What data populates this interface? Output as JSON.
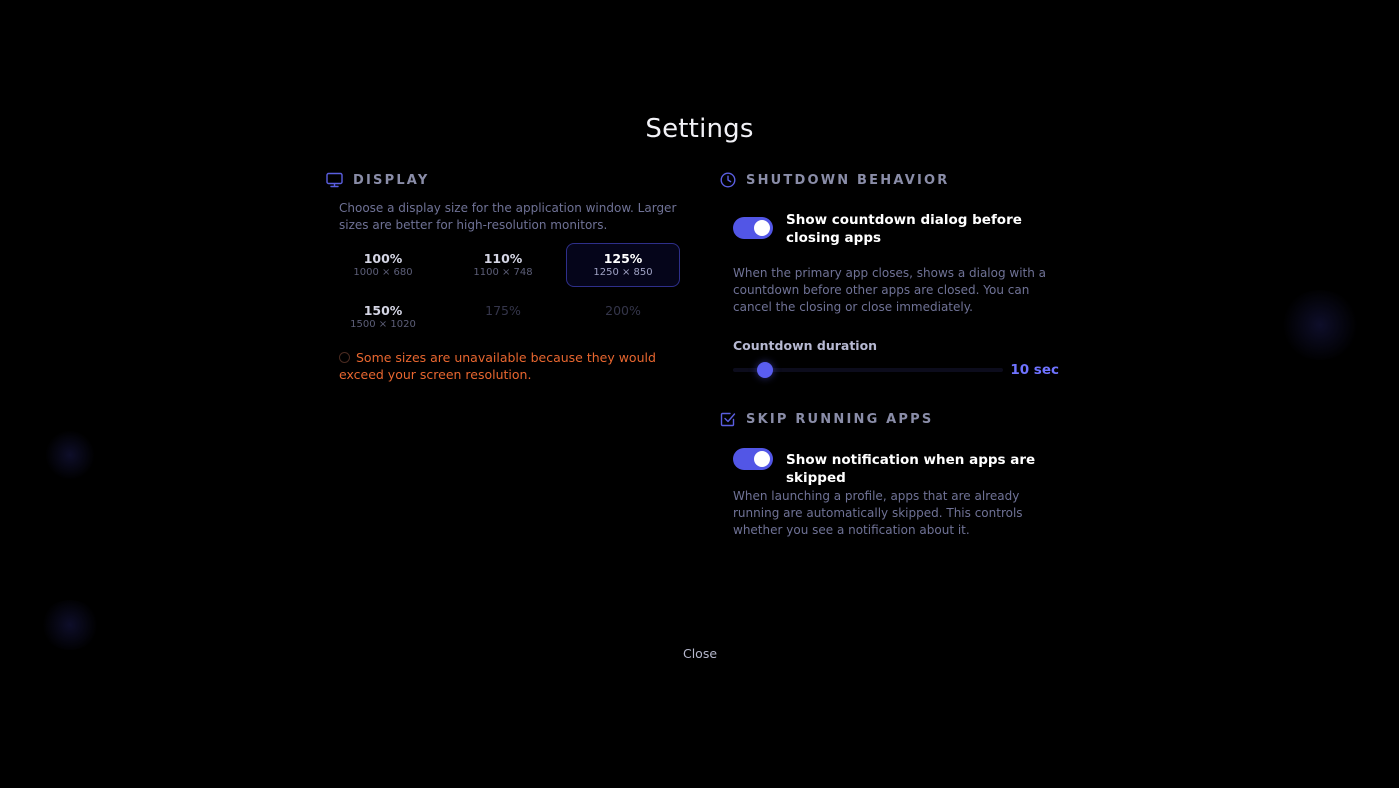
{
  "title": "Settings",
  "colors": {
    "accent": "#5256e6",
    "slider_value": "#6f73ff",
    "warning": "#e8662f",
    "background": "#000000"
  },
  "display": {
    "icon": "monitor-icon",
    "label": "DISPLAY",
    "description": "Choose a display size for the application window. Larger sizes are better for high-resolution monitors.",
    "options": [
      {
        "percent": "100%",
        "dimensions": "1000 × 680",
        "state": "available"
      },
      {
        "percent": "110%",
        "dimensions": "1100 × 748",
        "state": "available"
      },
      {
        "percent": "125%",
        "dimensions": "1250 × 850",
        "state": "selected"
      },
      {
        "percent": "150%",
        "dimensions": "1500 × 1020",
        "state": "available"
      },
      {
        "percent": "175%",
        "dimensions": "",
        "state": "disabled"
      },
      {
        "percent": "200%",
        "dimensions": "",
        "state": "disabled"
      }
    ],
    "warning": "Some sizes are unavailable because they would exceed your screen resolution."
  },
  "shutdown": {
    "icon": "clock-icon",
    "label": "SHUTDOWN BEHAVIOR",
    "toggle_label": "Show countdown dialog before closing apps",
    "toggle_on": true,
    "description": "When the primary app closes, shows a dialog with a countdown before other apps are closed. You can cancel the closing or close immediately.",
    "countdown_label": "Countdown duration",
    "countdown_value": "10 sec",
    "countdown_fraction": 0.12
  },
  "skip": {
    "icon": "checkbox-icon",
    "label": "SKIP RUNNING APPS",
    "toggle_label": "Show notification when apps are skipped",
    "toggle_on": true,
    "description": "When launching a profile, apps that are already running are automatically skipped. This controls whether you see a notification about it."
  },
  "close_label": "Close"
}
